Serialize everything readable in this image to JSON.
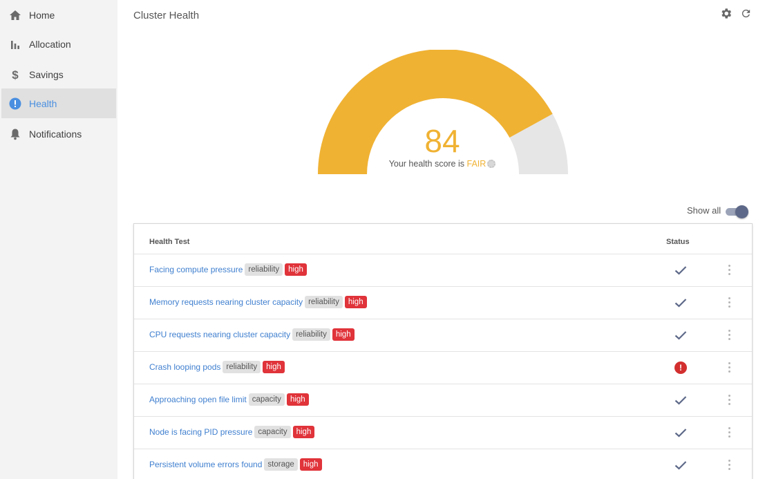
{
  "sidebar": {
    "items": [
      {
        "label": "Home",
        "icon": "home-icon"
      },
      {
        "label": "Allocation",
        "icon": "bar-chart-icon"
      },
      {
        "label": "Savings",
        "icon": "dollar-icon"
      },
      {
        "label": "Health",
        "icon": "alert-circle-icon",
        "active": true
      },
      {
        "label": "Notifications",
        "icon": "bell-icon"
      }
    ]
  },
  "header": {
    "title": "Cluster Health",
    "icons": [
      "gear-icon",
      "refresh-icon"
    ]
  },
  "health": {
    "score": "84",
    "score_fraction": 0.84,
    "caption_prefix": "Your health score is",
    "rating": "FAIR",
    "gauge_color": "#f0b233",
    "gauge_track_color": "#e6e6e6"
  },
  "toggle": {
    "label": "Show all",
    "on": true
  },
  "table": {
    "columns": {
      "test": "Health Test",
      "status": "Status"
    },
    "rows": [
      {
        "name": "Facing compute pressure",
        "category": "reliability",
        "severity": "high",
        "status": "pass"
      },
      {
        "name": "Memory requests nearing cluster capacity",
        "category": "reliability",
        "severity": "high",
        "status": "pass"
      },
      {
        "name": "CPU requests nearing cluster capacity",
        "category": "reliability",
        "severity": "high",
        "status": "pass"
      },
      {
        "name": "Crash looping pods",
        "category": "reliability",
        "severity": "high",
        "status": "fail"
      },
      {
        "name": "Approaching open file limit",
        "category": "capacity",
        "severity": "high",
        "status": "pass"
      },
      {
        "name": "Node is facing PID pressure",
        "category": "capacity",
        "severity": "high",
        "status": "pass"
      },
      {
        "name": "Persistent volume errors found",
        "category": "storage",
        "severity": "high",
        "status": "pass"
      }
    ],
    "status_fail_glyph": "!"
  },
  "colors": {
    "accent": "#4a8fe0",
    "link": "#3f7fcf",
    "severity_high": "#e0333a",
    "error": "#d32f2f",
    "check": "#5d6888"
  }
}
